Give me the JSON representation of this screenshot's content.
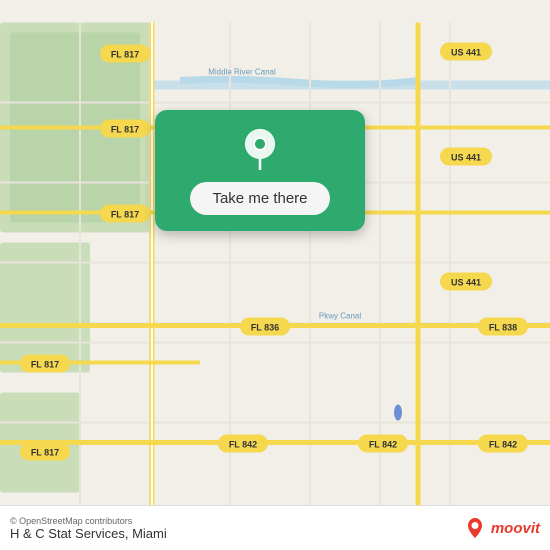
{
  "map": {
    "attribution": "© OpenStreetMap contributors",
    "location_name": "H & C Stat Services, Miami",
    "cta_button_label": "Take me there",
    "branding": "moovit"
  },
  "road_labels": [
    {
      "id": "fl817_1",
      "text": "FL 817"
    },
    {
      "id": "fl817_2",
      "text": "FL 817"
    },
    {
      "id": "fl817_3",
      "text": "FL 817"
    },
    {
      "id": "fl817_4",
      "text": "FL 817"
    },
    {
      "id": "fl817_5",
      "text": "FL 817"
    },
    {
      "id": "us441_1",
      "text": "US 441"
    },
    {
      "id": "us441_2",
      "text": "US 441"
    },
    {
      "id": "us441_3",
      "text": "US 441"
    },
    {
      "id": "fl836",
      "text": "FL 836"
    },
    {
      "id": "fl838",
      "text": "FL 838"
    },
    {
      "id": "fl842_1",
      "text": "FL 842"
    },
    {
      "id": "fl842_2",
      "text": "FL 842"
    },
    {
      "id": "fl842_3",
      "text": "FL 842"
    },
    {
      "id": "middle_river",
      "text": "Middle River Canal"
    },
    {
      "id": "pkwy_canal",
      "text": "Pkwy Canal"
    }
  ],
  "colors": {
    "map_bg": "#f2efe9",
    "park_green": "#c8e6c0",
    "water_blue": "#b8d9e8",
    "road_yellow": "#f5d84e",
    "road_white": "#ffffff",
    "road_gray": "#d4cfc8",
    "cta_green": "#2eaa6e",
    "bottom_bar_bg": "#ffffff",
    "moovit_red": "#e8392a"
  }
}
